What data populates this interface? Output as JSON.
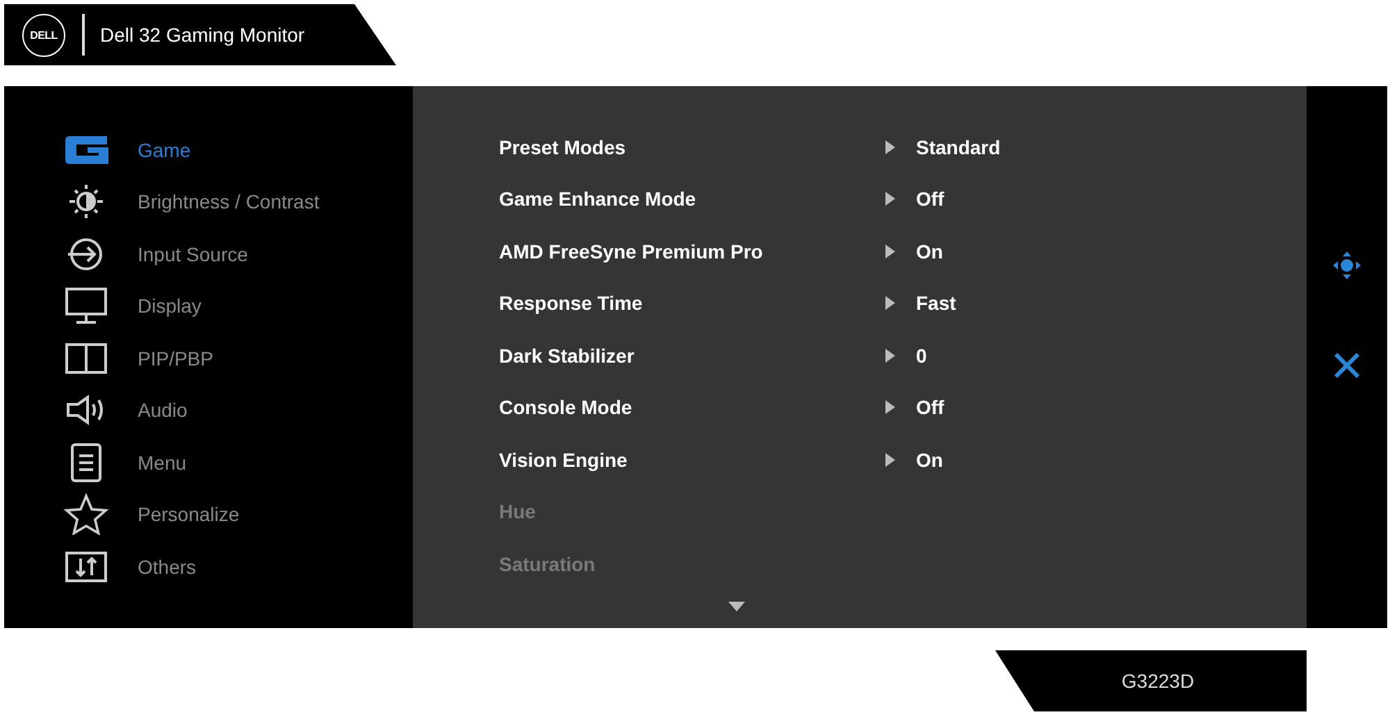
{
  "header": {
    "logo": "DELL",
    "title": "Dell 32 Gaming Monitor"
  },
  "sidebar": {
    "items": [
      {
        "label": "Game",
        "selected": true
      },
      {
        "label": "Brightness / Contrast",
        "selected": false
      },
      {
        "label": "Input Source",
        "selected": false
      },
      {
        "label": "Display",
        "selected": false
      },
      {
        "label": "PIP/PBP",
        "selected": false
      },
      {
        "label": "Audio",
        "selected": false
      },
      {
        "label": "Menu",
        "selected": false
      },
      {
        "label": "Personalize",
        "selected": false
      },
      {
        "label": "Others",
        "selected": false
      }
    ]
  },
  "settings": [
    {
      "label": "Preset Modes",
      "value": "Standard",
      "disabled": false
    },
    {
      "label": "Game Enhance Mode",
      "value": "Off",
      "disabled": false
    },
    {
      "label": "AMD FreeSyne Premium Pro",
      "value": "On",
      "disabled": false
    },
    {
      "label": "Response Time",
      "value": "Fast",
      "disabled": false
    },
    {
      "label": "Dark Stabilizer",
      "value": "0",
      "disabled": false
    },
    {
      "label": "Console Mode",
      "value": "Off",
      "disabled": false
    },
    {
      "label": "Vision Engine",
      "value": "On",
      "disabled": false
    },
    {
      "label": "Hue",
      "disabled": true
    },
    {
      "label": "Saturation",
      "disabled": true
    }
  ],
  "model": {
    "name": "G3223D"
  }
}
